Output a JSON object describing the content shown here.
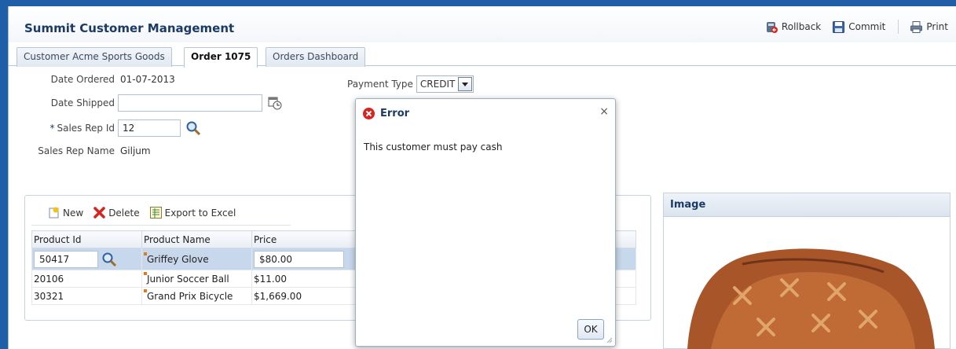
{
  "app": {
    "title": "Summit Customer Management"
  },
  "toolbar": {
    "rollback": "Rollback",
    "commit": "Commit",
    "print": "Print"
  },
  "tabs": [
    {
      "label": "Customer Acme Sports Goods",
      "active": false
    },
    {
      "label": "Order 1075",
      "active": true
    },
    {
      "label": "Orders Dashboard",
      "active": false
    }
  ],
  "form": {
    "date_ordered_label": "Date Ordered",
    "date_ordered_value": "01-07-2013",
    "date_shipped_label": "Date Shipped",
    "date_shipped_value": "",
    "sales_rep_id_required": "*",
    "sales_rep_id_label": "Sales Rep Id",
    "sales_rep_id_value": "12",
    "sales_rep_name_label": "Sales Rep Name",
    "sales_rep_name_value": "Giljum",
    "payment_type_label": "Payment Type",
    "payment_type_value": "CREDIT"
  },
  "items": {
    "new_label": "New",
    "delete_label": "Delete",
    "export_label": "Export to Excel",
    "columns": [
      "Product Id",
      "Product Name",
      "Price"
    ],
    "rows": [
      {
        "id": "50417",
        "name": "Griffey Glove",
        "price": "$80.00"
      },
      {
        "id": "20106",
        "name": "Junior Soccer Ball",
        "price": "$11.00"
      },
      {
        "id": "30321",
        "name": "Grand Prix Bicycle",
        "price": "$1,669.00"
      }
    ]
  },
  "image_panel": {
    "title": "Image"
  },
  "dialog": {
    "title": "Error",
    "message": "This customer must pay cash",
    "ok_label": "OK",
    "close_glyph": "×"
  },
  "colors": {
    "accent": "#1b3a66",
    "frame": "#1f5fa8",
    "selected_row": "#c8d8ec",
    "error": "#d8231f"
  }
}
